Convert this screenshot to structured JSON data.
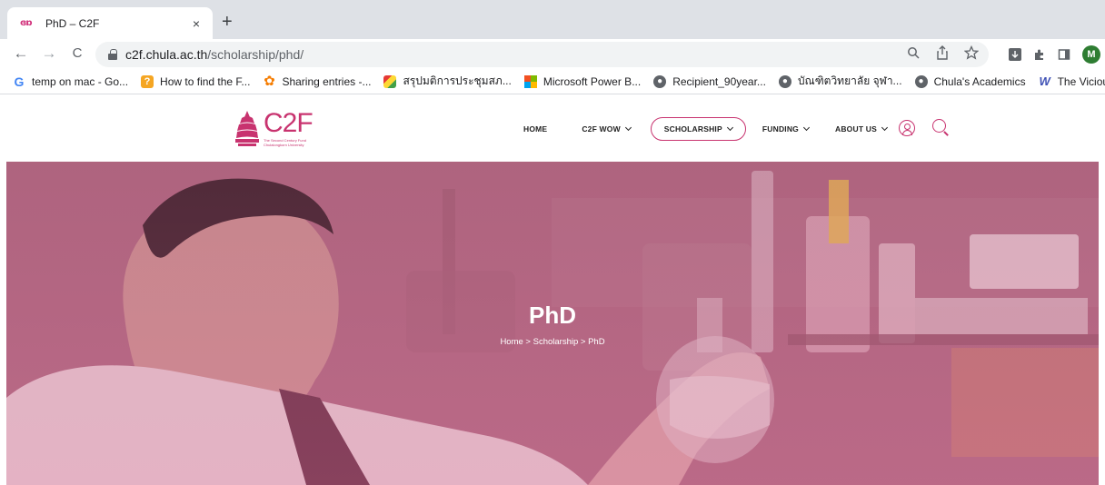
{
  "browser": {
    "tab_title": "PhD – C2F",
    "tab_favicon_text": "ɞɒ",
    "close_symbol": "×",
    "newtab_symbol": "+",
    "back_symbol": "←",
    "forward_symbol": "→",
    "reload_symbol": "C",
    "url_host": "c2f.chula.ac.th",
    "url_path": "/scholarship/phd/",
    "profile_initial": "M"
  },
  "bookmarks": [
    {
      "label": "temp on mac - Go...",
      "icon": "google-icon",
      "glyph": "G"
    },
    {
      "label": "How to find the F...",
      "icon": "orange-face-icon",
      "glyph": "?"
    },
    {
      "label": "Sharing entries -...",
      "icon": "gear-icon",
      "glyph": "✿"
    },
    {
      "label": "สรุปมติการประชุมสภ...",
      "icon": "colorful-icon",
      "glyph": ""
    },
    {
      "label": "Microsoft Power B...",
      "icon": "microsoft-icon",
      "glyph": ""
    },
    {
      "label": "Recipient_90year...",
      "icon": "globe-icon",
      "glyph": "●"
    },
    {
      "label": "บัณฑิตวิทยาลัย จุฬา...",
      "icon": "globe-icon",
      "glyph": "●"
    },
    {
      "label": "Chula's Academics",
      "icon": "globe-icon",
      "glyph": "●"
    },
    {
      "label": "The Vicious Cycle...",
      "icon": "w-icon",
      "glyph": "W"
    }
  ],
  "site": {
    "logo_text": "C2F",
    "logo_sub_1": "The Second Century Fund",
    "logo_sub_2": "Chulalongkorn University",
    "nav": [
      {
        "label": "HOME",
        "has_dropdown": false
      },
      {
        "label": "C2F WOW",
        "has_dropdown": true
      },
      {
        "label": "SCHOLARSHIP",
        "has_dropdown": true,
        "active": true
      },
      {
        "label": "FUNDING",
        "has_dropdown": true
      },
      {
        "label": "ABOUT US",
        "has_dropdown": true
      }
    ]
  },
  "hero": {
    "title": "PhD",
    "breadcrumb": {
      "home": "Home",
      "sep": " > ",
      "section": "Scholarship",
      "current": "PhD"
    }
  },
  "colors": {
    "brand": "#c8336f",
    "hero_tint": "#c77e96"
  }
}
